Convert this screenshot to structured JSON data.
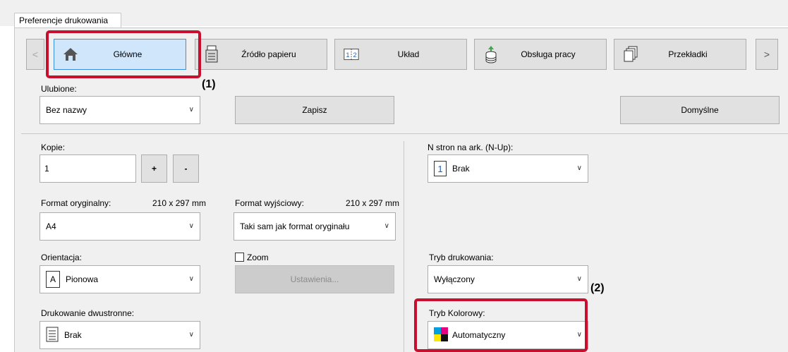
{
  "window": {
    "tab_label": "Preferencje drukowania"
  },
  "nav": {
    "prev_arrow": "<",
    "next_arrow": ">",
    "buttons": [
      {
        "label": "Główne",
        "icon": "home-icon",
        "selected": true
      },
      {
        "label": "Źródło papieru",
        "icon": "paper-tray-icon"
      },
      {
        "label": "Układ",
        "icon": "layout-icon"
      },
      {
        "label": "Obsługa pracy",
        "icon": "job-handling-icon"
      },
      {
        "label": "Przekładki",
        "icon": "inserts-icon"
      }
    ]
  },
  "favorites": {
    "label": "Ulubione:",
    "value": "Bez nazwy",
    "save_label": "Zapisz",
    "defaults_label": "Domyślne"
  },
  "copies": {
    "label": "Kopie:",
    "value": "1",
    "plus": "+",
    "minus": "-"
  },
  "original_size": {
    "label": "Format oryginalny:",
    "dims": "210 x 297 mm",
    "value": "A4"
  },
  "output_size": {
    "label": "Format wyjściowy:",
    "dims": "210 x 297 mm",
    "value": "Taki sam jak format oryginału"
  },
  "orientation": {
    "label": "Orientacja:",
    "icon_letter": "A",
    "value": "Pionowa"
  },
  "zoom": {
    "label": "Zoom",
    "checked": false,
    "settings_label": "Ustawienia..."
  },
  "duplex": {
    "label": "Drukowanie dwustronne:",
    "value": "Brak"
  },
  "nup": {
    "label": "N stron na ark. (N-Up):",
    "icon_number": "1",
    "value": "Brak"
  },
  "print_mode": {
    "label": "Tryb drukowania:",
    "value": "Wyłączony"
  },
  "color_mode": {
    "label": "Tryb Kolorowy:",
    "value": "Automatyczny"
  },
  "callouts": {
    "one": "(1)",
    "two": "(2)"
  },
  "colors": {
    "highlight": "#c8102e",
    "selected_bg": "#cfe6fb",
    "selected_border": "#3c8ee0",
    "panel_bg": "#f0f0f0"
  }
}
